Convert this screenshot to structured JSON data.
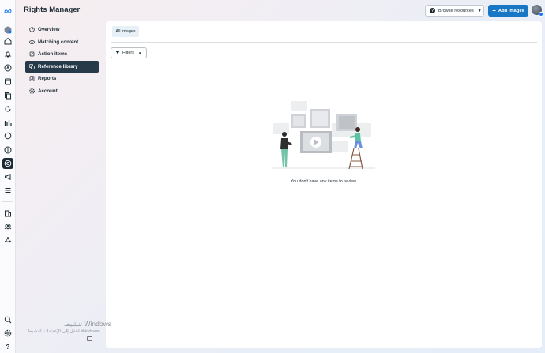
{
  "app": {
    "title": "Rights Manager"
  },
  "rail": {
    "icons": [
      "meta-logo-icon",
      "profile-icon",
      "home-icon",
      "notifications-icon",
      "ads-icon",
      "calendar-icon",
      "pages-icon",
      "refresh-icon",
      "insights-icon",
      "messenger-icon",
      "monetization-icon",
      "rights-manager-icon",
      "megaphone-icon",
      "menu-icon",
      "business-icon",
      "people-icon",
      "integrations-icon",
      "search-icon",
      "settings-icon",
      "help-icon"
    ]
  },
  "nav": {
    "items": [
      {
        "label": "Overview",
        "icon": "overview-icon"
      },
      {
        "label": "Matching content",
        "icon": "matching-content-icon"
      },
      {
        "label": "Action items",
        "icon": "action-items-icon"
      },
      {
        "label": "Reference library",
        "icon": "reference-library-icon",
        "active": true
      },
      {
        "label": "Reports",
        "icon": "reports-icon"
      },
      {
        "label": "Account",
        "icon": "account-icon"
      }
    ]
  },
  "header": {
    "browse_label": "Browse resources",
    "add_label": "Add Images"
  },
  "main": {
    "tab_label": "All images",
    "filters_label": "Filters",
    "empty_message": "You don't have any items to review."
  },
  "watermark": {
    "line1": "تنشيط Windows",
    "line2": "انتقل إلى الإعدادات لتنشيط Windows"
  },
  "colors": {
    "primary": "#1877c4",
    "dark": "#1c2b33",
    "active_nav": "#263a4a"
  }
}
